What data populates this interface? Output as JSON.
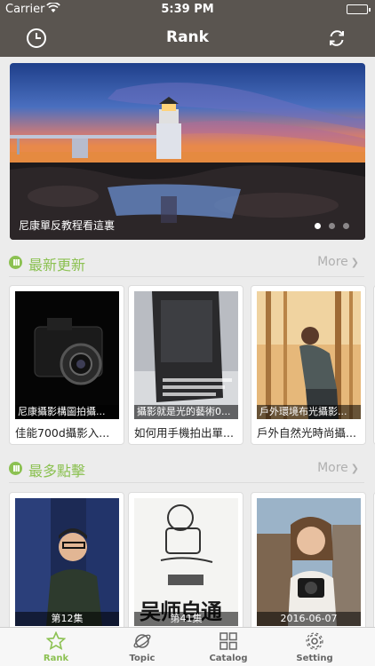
{
  "status_bar": {
    "carrier": "Carrier",
    "time": "5:39 PM"
  },
  "nav": {
    "title": "Rank",
    "left_icon": "clock-icon",
    "right_icon": "refresh-icon"
  },
  "banner": {
    "caption": "尼康單反教程看這裏",
    "page_count": 3,
    "active_page": 1
  },
  "sections": [
    {
      "title": "最新更新",
      "more_label": "More",
      "cards": [
        {
          "overlay": "尼康攝影構圖拍攝...",
          "name": "佳能700d攝影入..."
        },
        {
          "overlay": "攝影就是光的藝術0...",
          "name": "如何用手機拍出單..."
        },
        {
          "overlay": "戶外環境布光攝影...",
          "name": "戶外自然光時尚攝..."
        }
      ]
    },
    {
      "title": "最多點擊",
      "more_label": "More",
      "cards": [
        {
          "overlay": "第12集"
        },
        {
          "overlay": "第41集",
          "cover_text": "吴师自通"
        },
        {
          "overlay": "2016-06-07"
        }
      ]
    }
  ],
  "tabs": [
    {
      "label": "Rank",
      "icon": "star-icon",
      "active": true
    },
    {
      "label": "Topic",
      "icon": "planet-icon",
      "active": false
    },
    {
      "label": "Catalog",
      "icon": "grid-icon",
      "active": false
    },
    {
      "label": "Setting",
      "icon": "gear-icon",
      "active": false
    }
  ],
  "colors": {
    "nav_bg": "#5a5550",
    "accent": "#8cc152",
    "more": "#b0b0b0"
  }
}
